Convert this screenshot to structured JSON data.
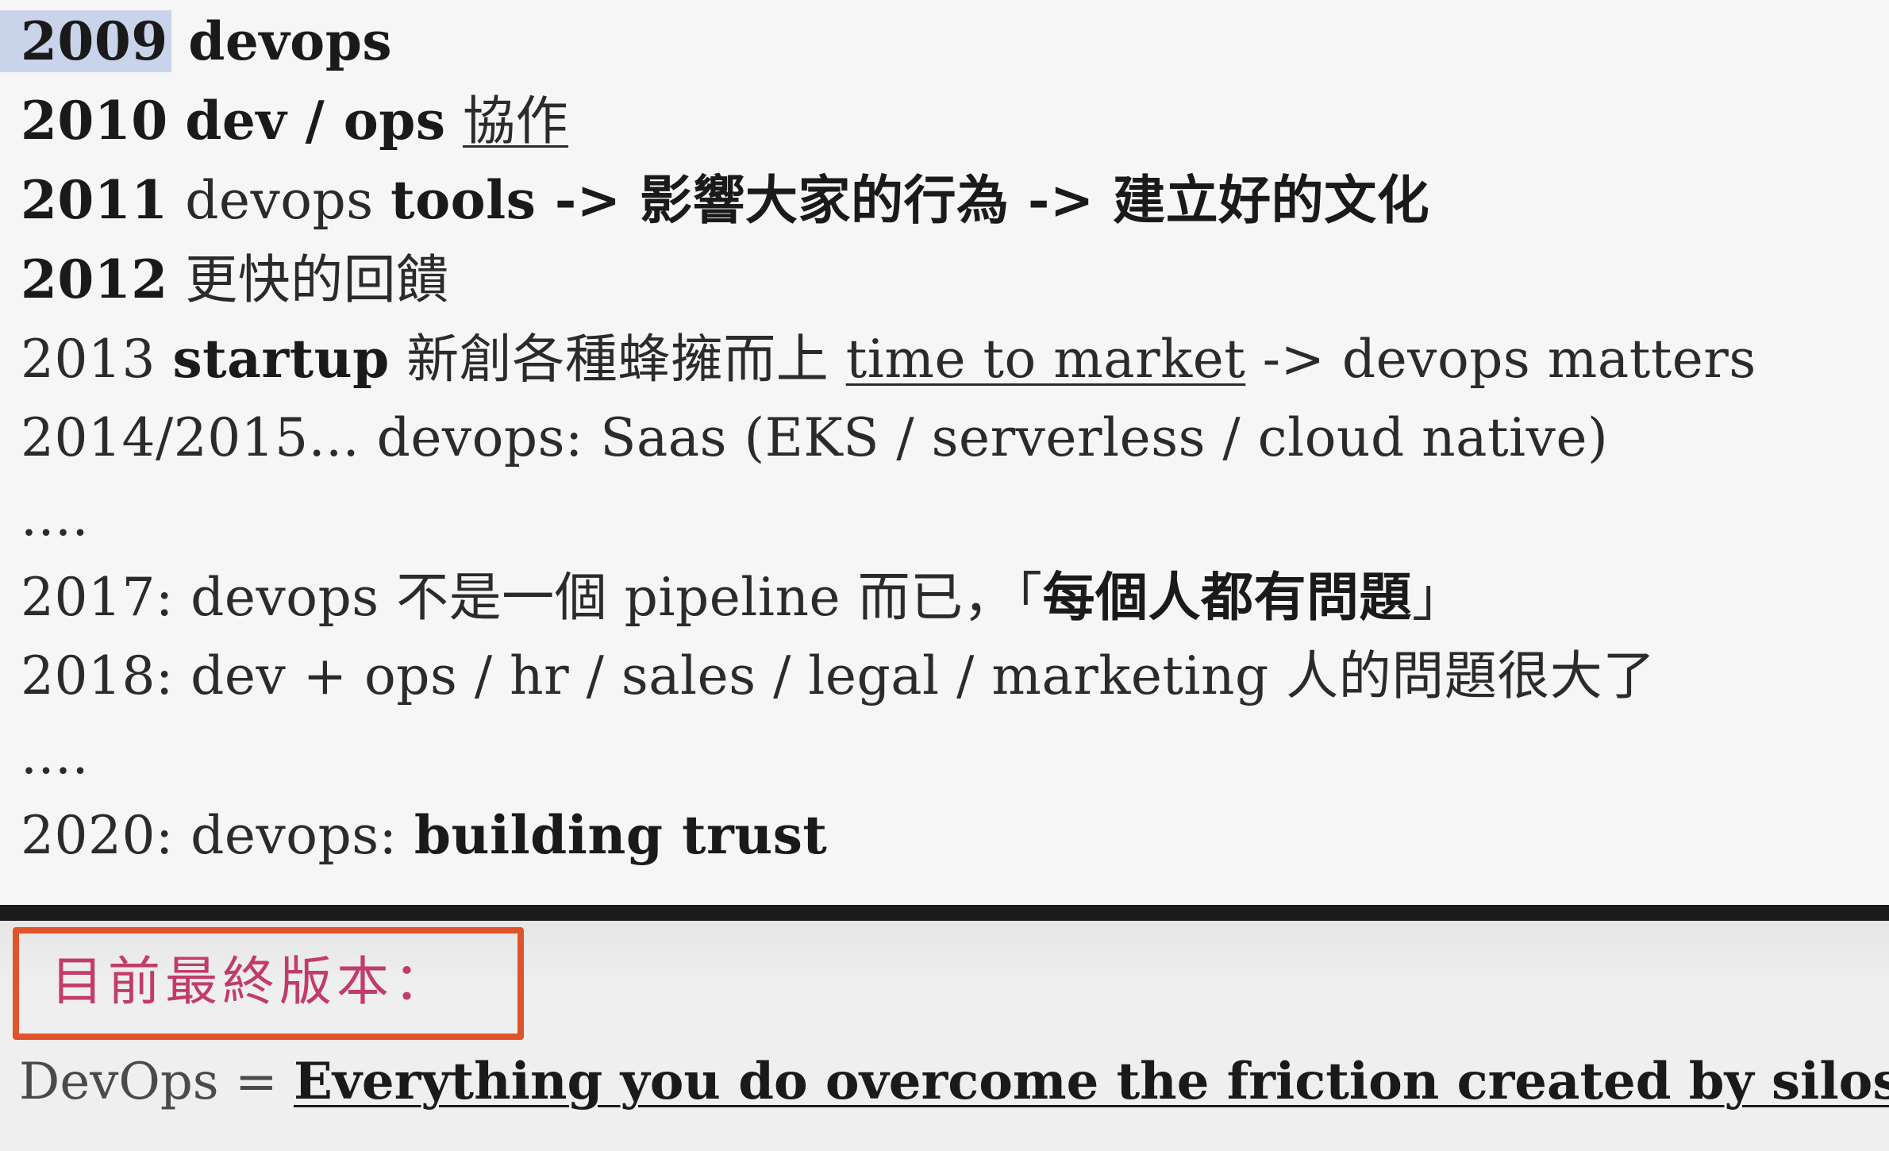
{
  "document": {
    "lines": [
      {
        "year": "2009",
        "bold_text": "devops"
      },
      {
        "year": "2010",
        "bold_text": "dev / ops",
        "underlined_text": "協作"
      },
      {
        "year": "2011",
        "plain_text": "devops",
        "bold_text": "tools -> 影響大家的行為 -> 建立好的文化"
      },
      {
        "year": "2012",
        "plain_text": "更快的回饋"
      },
      {
        "year": "2013",
        "bold_text": "startup",
        "plain_text": "新創各種蜂擁而上",
        "underlined_text": "time to market",
        "tail_text": "-> devops matters"
      },
      {
        "text": "2014/2015... devops: Saas (EKS / serverless / cloud native)"
      },
      {
        "text": "...."
      },
      {
        "prefix": "2017: devops 不是一個 pipeline 而已，「",
        "bold_text": "每個人都有問題",
        "suffix": "」"
      },
      {
        "text": "2018: dev + ops / hr / sales / legal / marketing 人的問題很大了"
      },
      {
        "text": "...."
      },
      {
        "prefix": "2020: devops:",
        "bold_text": "building trust"
      }
    ]
  },
  "callout": {
    "label": "目前最終版本：",
    "border_color": "#e0532b",
    "text_color": "#c23b6b"
  },
  "definition": {
    "prefix": "DevOps =",
    "statement": "Everything you do overcome the friction created by silos."
  },
  "colors": {
    "highlight": "#c9d3ea",
    "separator": "#1c1c1c"
  }
}
